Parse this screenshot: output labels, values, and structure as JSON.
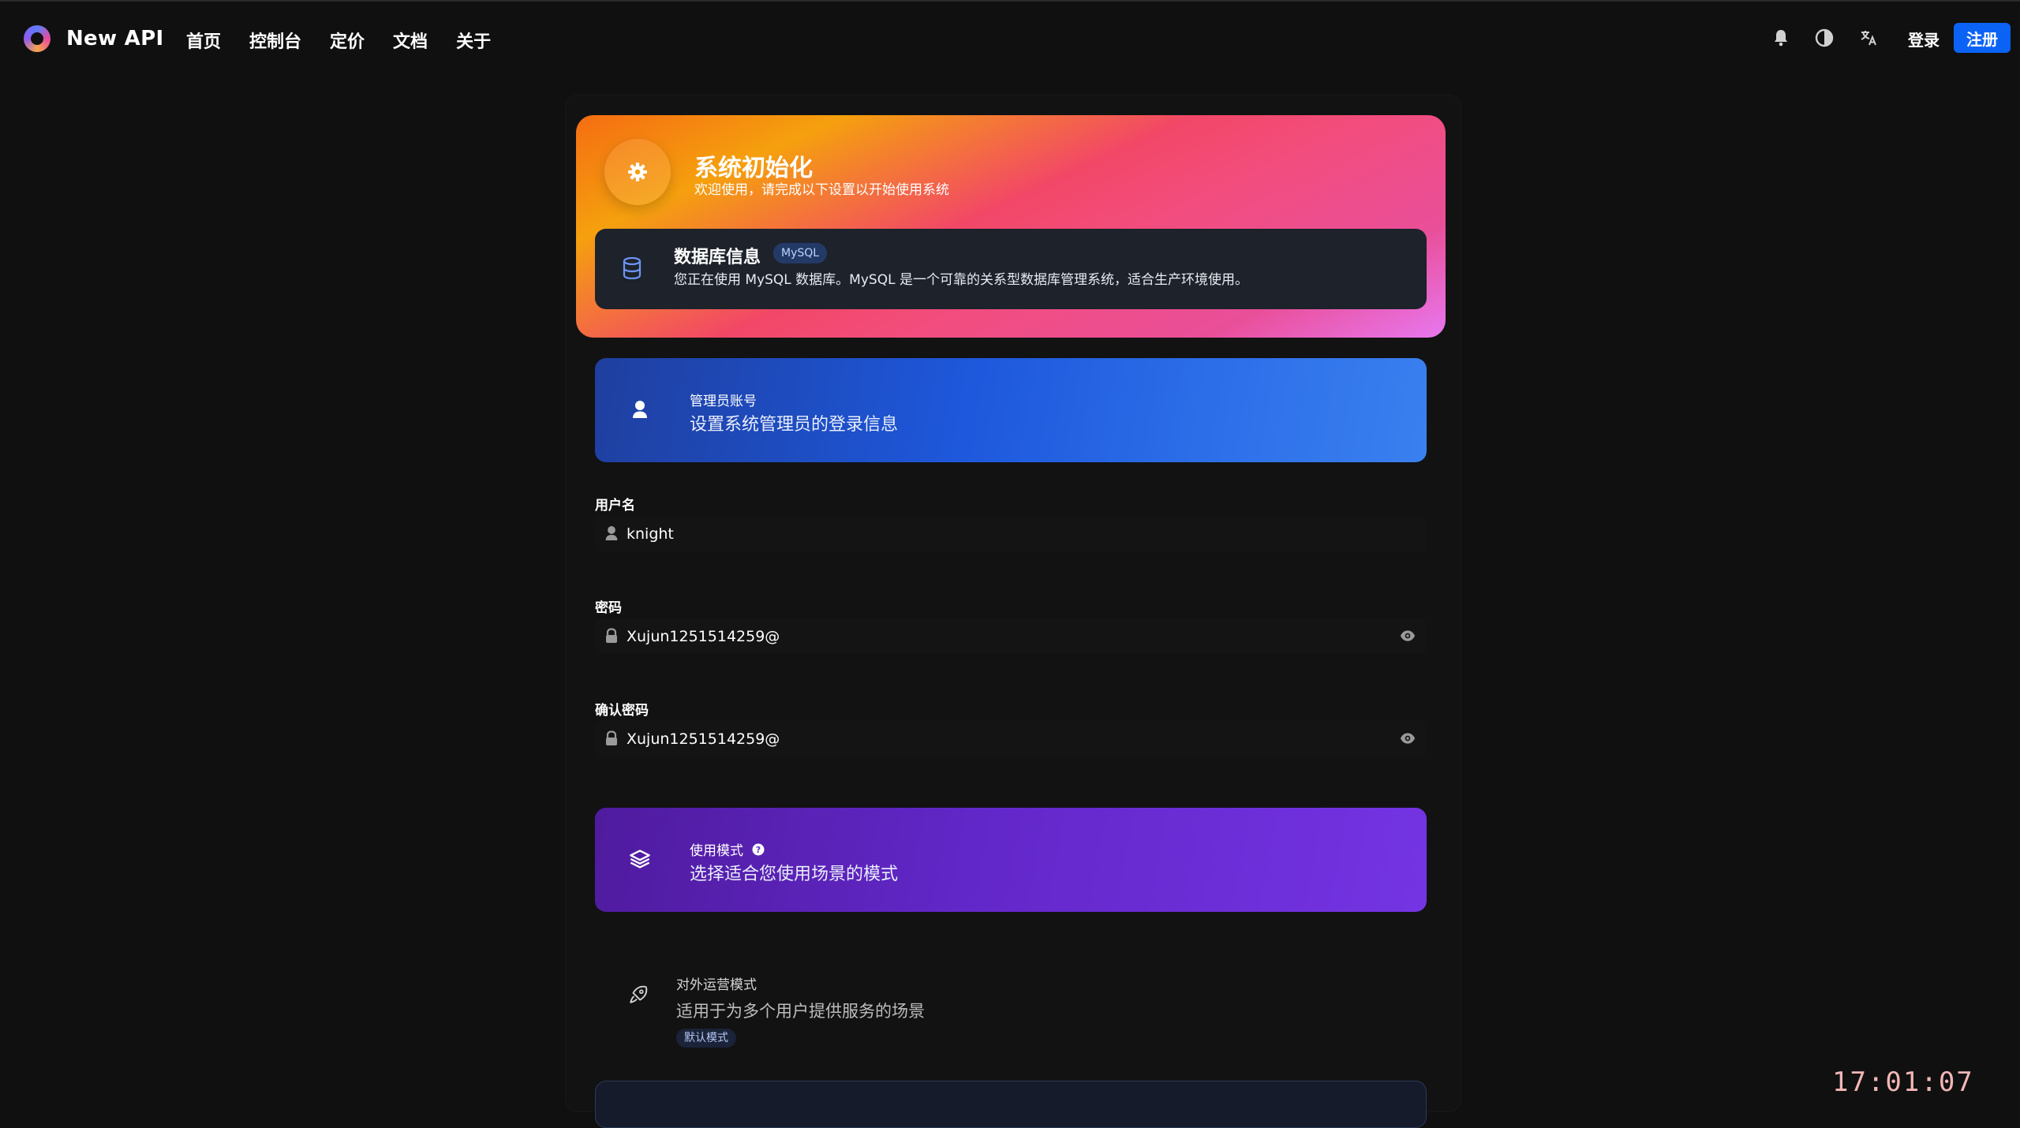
{
  "header": {
    "brand": "New API",
    "nav": [
      "首页",
      "控制台",
      "定价",
      "文档",
      "关于"
    ],
    "icons": [
      "bell-icon",
      "theme-toggle-icon",
      "translate-icon"
    ],
    "login_label": "登录",
    "register_label": "注册",
    "accent": "#0b63f6"
  },
  "hero": {
    "title": "系统初始化",
    "subtitle": "欢迎使用，请完成以下设置以开始使用系统",
    "icon": "gear-icon",
    "db": {
      "title": "数据库信息",
      "badge": "MySQL",
      "description": "您正在使用 MySQL 数据库。MySQL 是一个可靠的关系型数据库管理系统，适合生产环境使用。",
      "icon": "database-icon"
    }
  },
  "admin": {
    "small": "管理员账号",
    "big": "设置系统管理员的登录信息",
    "icon": "user-icon"
  },
  "form": {
    "username_label": "用户名",
    "username_value": "knight",
    "password_label": "密码",
    "password_value": "Xujun1251514259@",
    "confirm_label": "确认密码",
    "confirm_value": "Xujun1251514259@"
  },
  "mode": {
    "small": "使用模式",
    "big": "选择适合您使用场景的模式",
    "icon": "layers-icon",
    "option": {
      "title": "对外运营模式",
      "description": "适用于为多个用户提供服务的场景",
      "badge": "默认模式",
      "icon": "rocket-icon"
    }
  },
  "clock": "17:01:07"
}
